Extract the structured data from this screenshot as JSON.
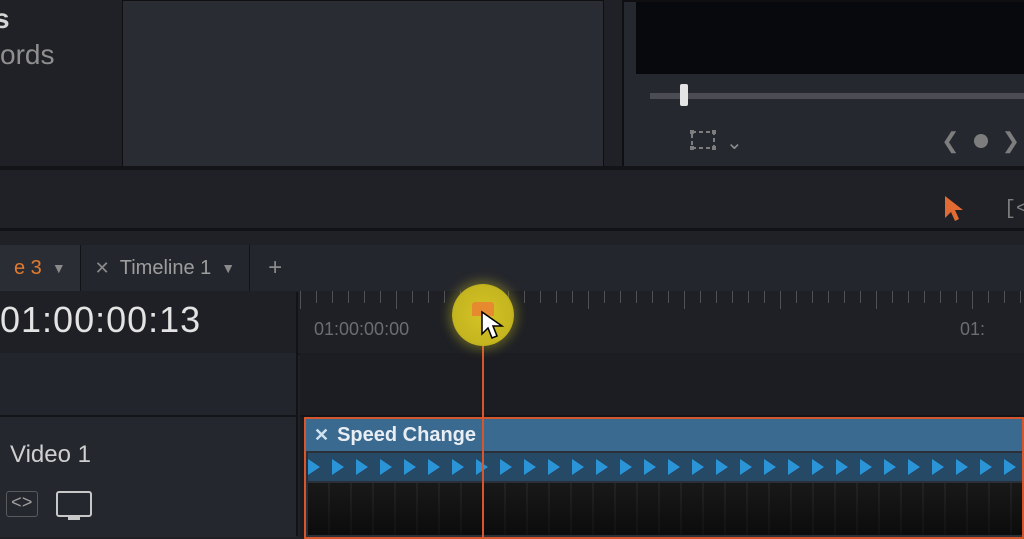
{
  "panel": {
    "s_text": "s",
    "ords_text": "ords"
  },
  "tabs": {
    "active_tab_suffix": "e 3",
    "second_tab": "Timeline 1"
  },
  "timecode": "01:00:00:13",
  "ruler": {
    "label1": "01:00:00:00",
    "label2": "01:"
  },
  "track": {
    "name": "Video 1"
  },
  "clip": {
    "title": "Speed Change"
  }
}
